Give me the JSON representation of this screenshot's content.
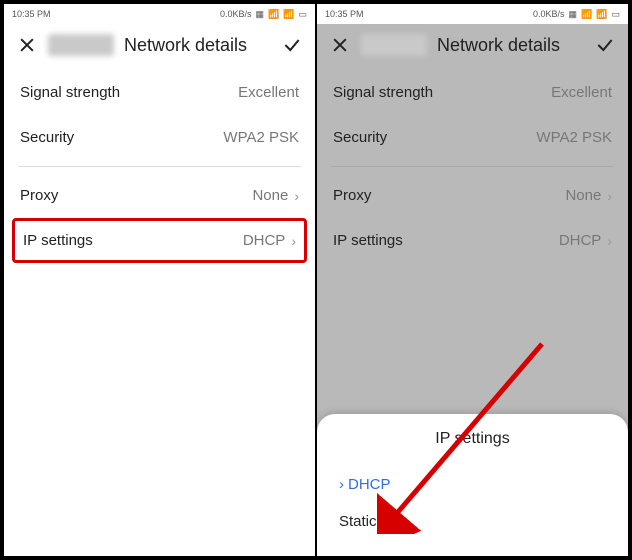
{
  "status": {
    "time": "10:35 PM",
    "net": "0.0KB/s"
  },
  "header": {
    "title": "Network details"
  },
  "rows": {
    "signal": {
      "label": "Signal strength",
      "value": "Excellent"
    },
    "security": {
      "label": "Security",
      "value": "WPA2 PSK"
    },
    "proxy": {
      "label": "Proxy",
      "value": "None"
    },
    "ip": {
      "label": "IP settings",
      "value": "DHCP"
    }
  },
  "sheet": {
    "title": "IP settings",
    "option_selected": "DHCP",
    "option_other": "Static"
  }
}
